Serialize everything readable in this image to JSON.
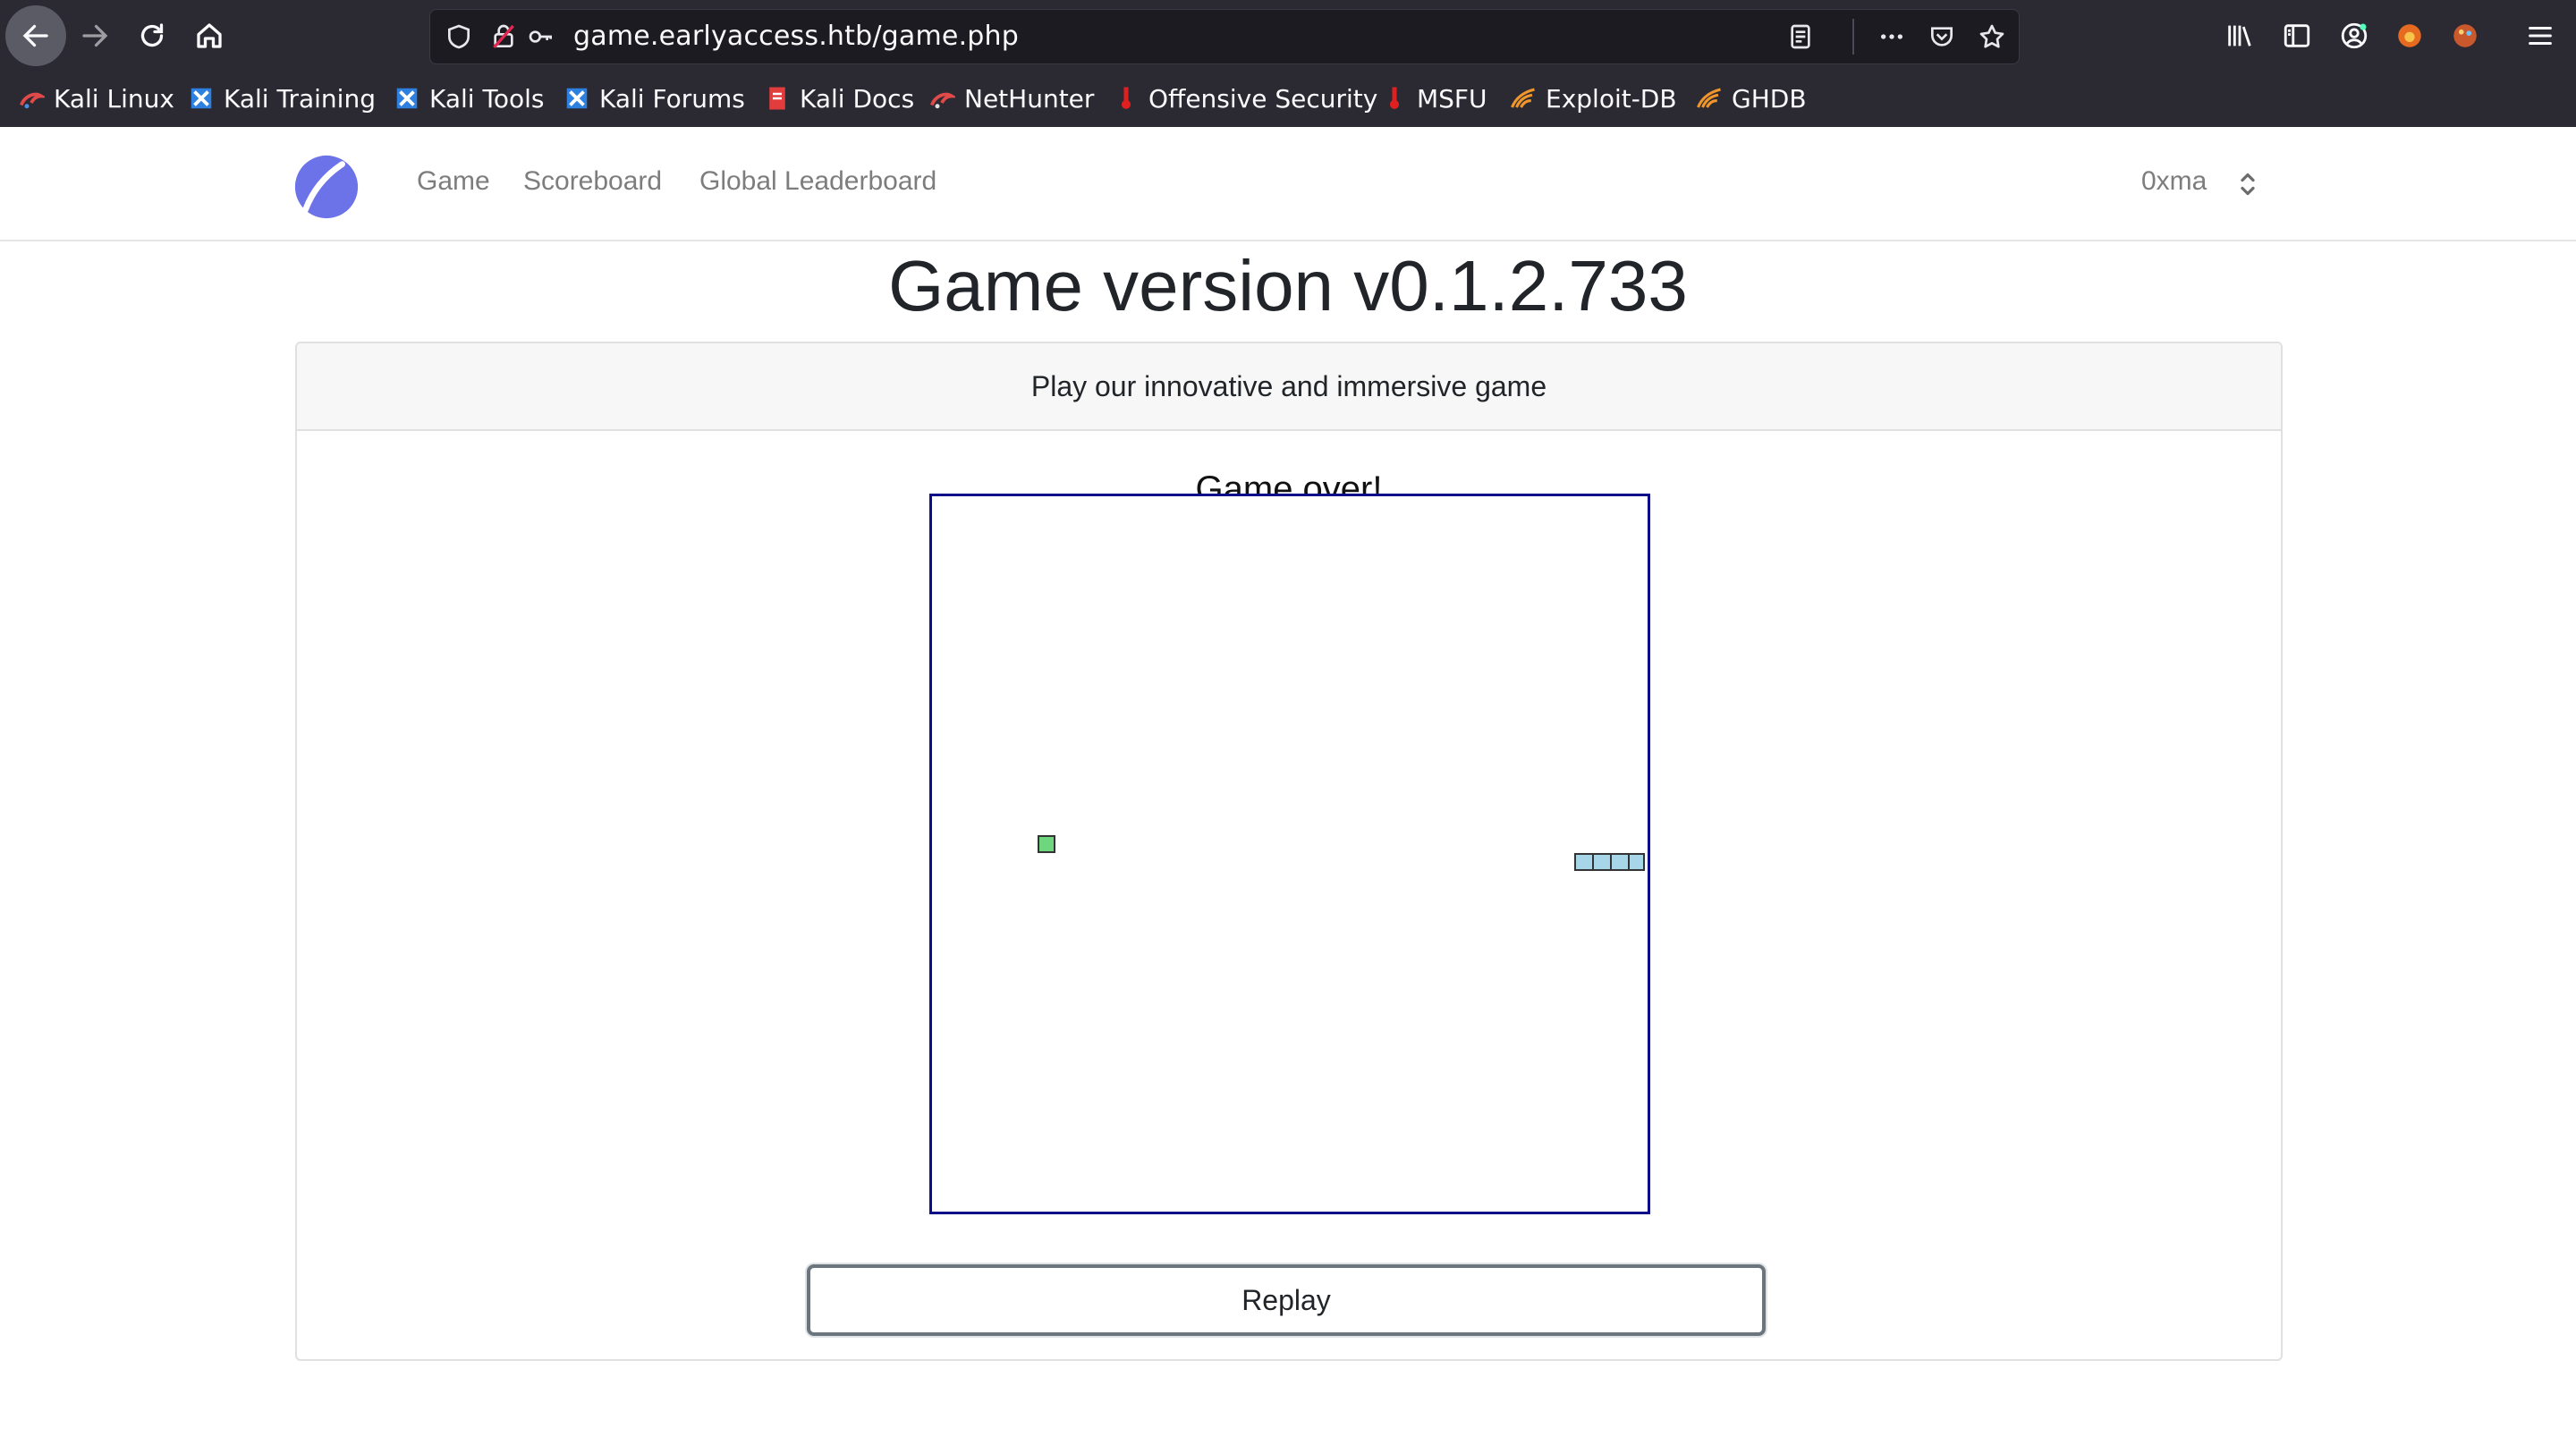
{
  "browser": {
    "url": "game.earlyaccess.htb/game.php",
    "bookmarks": [
      {
        "label": "Kali Linux",
        "icon": "kali-dragon-icon"
      },
      {
        "label": "Kali Training",
        "icon": "kali-training-icon"
      },
      {
        "label": "Kali Tools",
        "icon": "kali-tools-icon"
      },
      {
        "label": "Kali Forums",
        "icon": "kali-forums-icon"
      },
      {
        "label": "Kali Docs",
        "icon": "kali-docs-icon"
      },
      {
        "label": "NetHunter",
        "icon": "nethunter-icon"
      },
      {
        "label": "Offensive Security",
        "icon": "offsec-icon"
      },
      {
        "label": "MSFU",
        "icon": "msfu-icon"
      },
      {
        "label": "Exploit-DB",
        "icon": "exploit-db-icon"
      },
      {
        "label": "GHDB",
        "icon": "ghdb-icon"
      }
    ]
  },
  "navbar": {
    "links": [
      {
        "label": "Game"
      },
      {
        "label": "Scoreboard"
      },
      {
        "label": "Global Leaderboard"
      }
    ],
    "username": "0xma"
  },
  "main": {
    "title": "Game version v0.1.2.733",
    "card_header": "Play our innovative and immersive game",
    "status": "Game over!",
    "replay_label": "Replay"
  },
  "colors": {
    "board_border": "#0d0d8a",
    "food": "#6fd680",
    "snake": "#a7d6e8",
    "logo": "#6c72e8"
  }
}
